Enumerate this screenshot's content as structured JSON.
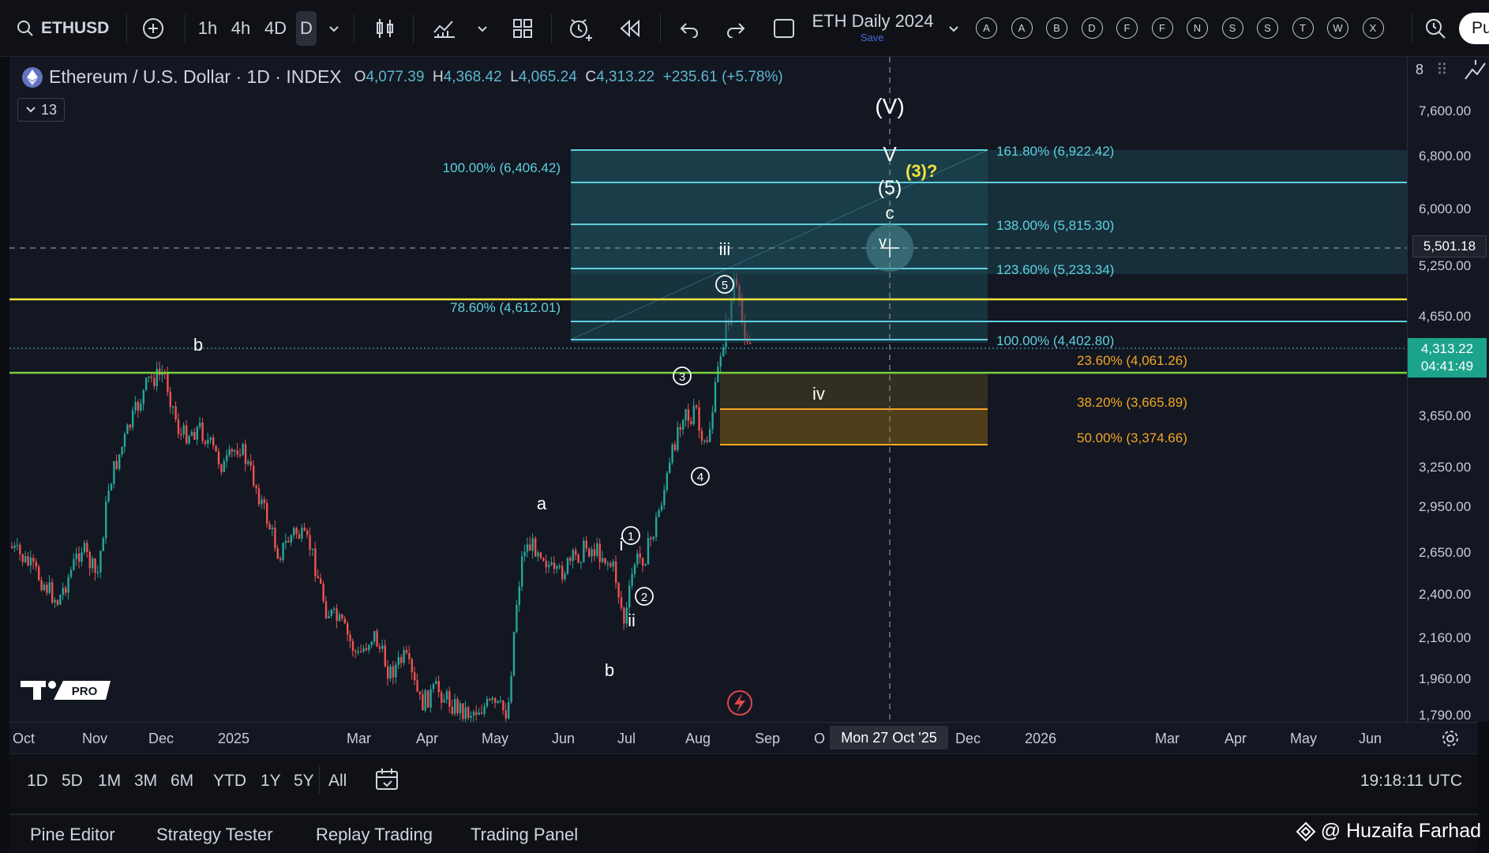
{
  "toolbar": {
    "symbol": "ETHUSD",
    "intervals": [
      "1h",
      "4h",
      "4D",
      "D"
    ],
    "active_interval": "D",
    "layout_name": "ETH Daily 2024",
    "layout_save": "Save",
    "alert_letters": [
      "A",
      "A",
      "B",
      "D",
      "F",
      "F",
      "N",
      "S",
      "S",
      "T",
      "W",
      "X"
    ],
    "publish_label": "Pu"
  },
  "legend": {
    "title": "Ethereum / U.S. Dollar · 1D · INDEX",
    "o_label": "O",
    "o_value": "4,077.39",
    "h_label": "H",
    "h_value": "4,368.42",
    "l_label": "L",
    "l_value": "4,065.24",
    "c_label": "C",
    "c_value": "4,313.22",
    "change": "+235.61 (+5.78%)",
    "indicators_count": "13"
  },
  "price_axis": {
    "ticks": [
      "7,600.00",
      "6,800.00",
      "6,000.00",
      "5,250.00",
      "4,650.00",
      "3,650.00",
      "3,250.00",
      "2,950.00",
      "2,650.00",
      "2,400.00",
      "2,160.00",
      "1,960.00",
      "1,790.00"
    ],
    "crosshair_price": "5,501.18",
    "last_price": "4,313.22",
    "countdown": "04:41:49",
    "top_label": "8"
  },
  "time_axis": {
    "ticks": [
      "Oct",
      "Nov",
      "Dec",
      "2025",
      "Mar",
      "Apr",
      "May",
      "Jun",
      "Jul",
      "Aug",
      "Sep",
      "O",
      "Dec",
      "2026",
      "Mar",
      "Apr",
      "May",
      "Jun"
    ],
    "crosshair_date": "Mon 27 Oct '25"
  },
  "fib_extension": {
    "left_label": "100.00% (6,406.42)",
    "mid_label": "78.60% (4,612.01)",
    "levels": [
      "161.80% (6,922.42)",
      "138.00% (5,815.30)",
      "123.60% (5,233.34)",
      "100.00% (4,402.80)"
    ]
  },
  "fib_retracement": {
    "levels": [
      "23.60% (4,061.26)",
      "38.20% (3,665.89)",
      "50.00% (3,374.66)"
    ]
  },
  "wave_labels": {
    "V_major": "(V)",
    "v_upper": "V",
    "three_q": "(3)?",
    "five": "(5)",
    "c": "c",
    "v_small": "v",
    "iii": "iii",
    "five_circle": "5",
    "three_circle": "3",
    "four_circle": "4",
    "one_circle": "1",
    "two_circle": "2",
    "i": "i",
    "ii": "ii",
    "iv": "iv",
    "a": "a",
    "b_top": "b",
    "b_bottom": "b"
  },
  "branding": {
    "logo": "17",
    "pro": "PRO"
  },
  "range_bar": {
    "ranges": [
      "1D",
      "5D",
      "1M",
      "3M",
      "6M",
      "YTD",
      "1Y",
      "5Y",
      "All"
    ],
    "clock": "19:18:11 UTC"
  },
  "panels": [
    "Pine Editor",
    "Strategy Tester",
    "Replay Trading",
    "Trading Panel"
  ],
  "watermark": "@ Huzaifa Farhad",
  "colors": {
    "bull": "#26a69a",
    "bear": "#ef5350",
    "fib_ext": "#5fd0df",
    "fib_ret": "#f5a623",
    "yellow_line": "#f2e23a",
    "green_line": "#7ccf3e",
    "accent": "#2962ff"
  }
}
